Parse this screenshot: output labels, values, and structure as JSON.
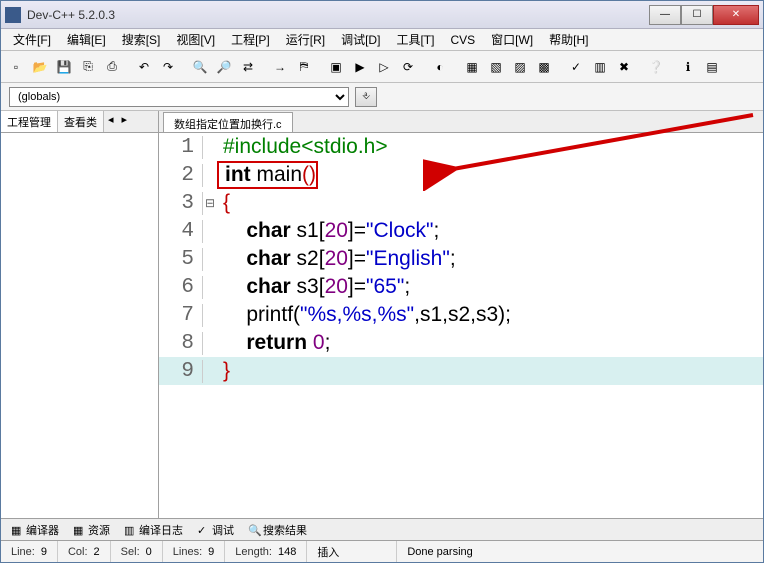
{
  "window": {
    "title": "Dev-C++ 5.2.0.3"
  },
  "menus": [
    "文件[F]",
    "编辑[E]",
    "搜索[S]",
    "视图[V]",
    "工程[P]",
    "运行[R]",
    "调试[D]",
    "工具[T]",
    "CVS",
    "窗口[W]",
    "帮助[H]"
  ],
  "globals": {
    "value": "(globals)"
  },
  "sidebar": {
    "tabs": [
      "工程管理",
      "查看类"
    ],
    "nav": [
      "◂",
      "▸"
    ]
  },
  "file_tab": "数组指定位置加换行.c",
  "code": {
    "lines": [
      {
        "n": "1",
        "fold": "",
        "html": "<span class='inc'>#include&lt;stdio.h&gt;</span>"
      },
      {
        "n": "2",
        "fold": "",
        "html": "<span class='kw'>int</span> main<span class='paren'>()</span>",
        "boxed": true
      },
      {
        "n": "3",
        "fold": "⊟",
        "html": "<span class='paren'>{</span>"
      },
      {
        "n": "4",
        "fold": "",
        "html": "    <span class='kw'>char</span> s1[<span class='num'>20</span>]=<span class='str'>\"Clock\"</span>;"
      },
      {
        "n": "5",
        "fold": "",
        "html": "    <span class='kw'>char</span> s2[<span class='num'>20</span>]=<span class='str'>\"English\"</span>;"
      },
      {
        "n": "6",
        "fold": "",
        "html": "    <span class='kw'>char</span> s3[<span class='num'>20</span>]=<span class='str'>\"65\"</span>;"
      },
      {
        "n": "7",
        "fold": "",
        "html": "    printf(<span class='str'>\"%s,%s,%s\"</span>,s1,s2,s3);"
      },
      {
        "n": "8",
        "fold": "",
        "html": "    <span class='kw'>return</span> <span class='num'>0</span>;"
      },
      {
        "n": "9",
        "fold": "",
        "html": "<span class='paren'>}</span>",
        "hl": true
      }
    ]
  },
  "bottom_tabs": [
    "编译器",
    "资源",
    "编译日志",
    "调试",
    "搜索结果"
  ],
  "status": {
    "line_label": "Line:",
    "line": "9",
    "col_label": "Col:",
    "col": "2",
    "sel_label": "Sel:",
    "sel": "0",
    "lines_label": "Lines:",
    "lines": "9",
    "length_label": "Length:",
    "length": "148",
    "insert": "插入",
    "parse": "Done parsing"
  },
  "toolbar_icons": [
    "new",
    "open",
    "save",
    "saveall",
    "print",
    "",
    "undo",
    "redo",
    "",
    "find",
    "replace",
    "findnext",
    "",
    "goto",
    "bookmark",
    "",
    "compile",
    "run",
    "compilerun",
    "rebuild",
    "",
    "debug",
    "",
    "layout1",
    "layout2",
    "layout3",
    "layout4",
    "",
    "check",
    "chart",
    "stop",
    "",
    "help",
    "",
    "about",
    "info"
  ],
  "bottom_icons": [
    "▦",
    "▦",
    "▦",
    "✓",
    "▦"
  ]
}
